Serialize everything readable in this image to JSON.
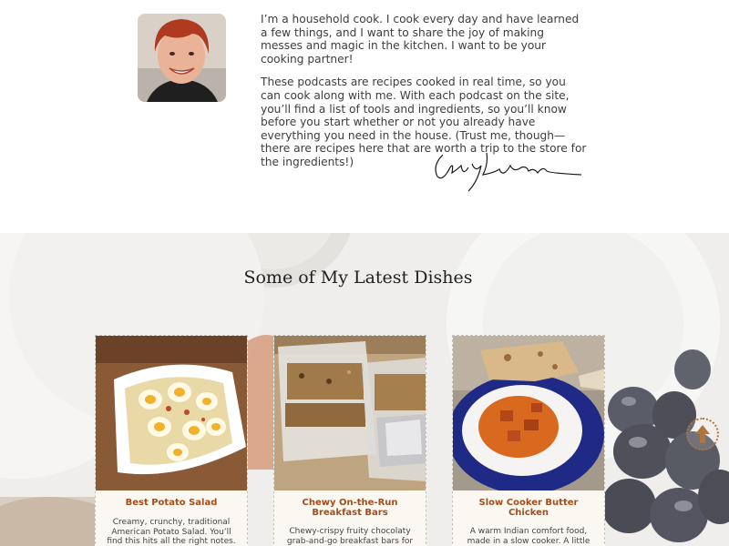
{
  "about": {
    "paragraph_1": "I’m a household cook.  I cook every day and have learned a few things, and I want to share the joy of making messes and magic in the kitchen.  I want to be your cooking partner!",
    "paragraph_2": "These podcasts are recipes cooked in real time, so you can cook along with me.  With each podcast on the site, you’ll find a list of tools and ingredients, so you’ll know before you start whether or not you already have everything you need in the house.  (Trust me, though—there are recipes here that are worth a trip to the store for the ingredients!)"
  },
  "section": {
    "title": "Some of My Latest Dishes"
  },
  "dishes": [
    {
      "title": "Best Potato Salad",
      "description": "Creamy, crunchy, traditional American Potato Salad. You’ll find this hits all the right notes."
    },
    {
      "title": "Chewy On-the-Run Breakfast Bars",
      "description": "Chewy-crispy fruity chocolaty grab-and-go breakfast bars for"
    },
    {
      "title": "Slow Cooker Butter Chicken",
      "description": "A warm Indian comfort food, made in a slow cooker. A little"
    }
  ],
  "colors": {
    "accent": "#a14d1c",
    "scroll_button": "#b0753f",
    "section_bg": "#efeeec"
  },
  "icons": {
    "scroll_top": "arrow-up-icon"
  }
}
